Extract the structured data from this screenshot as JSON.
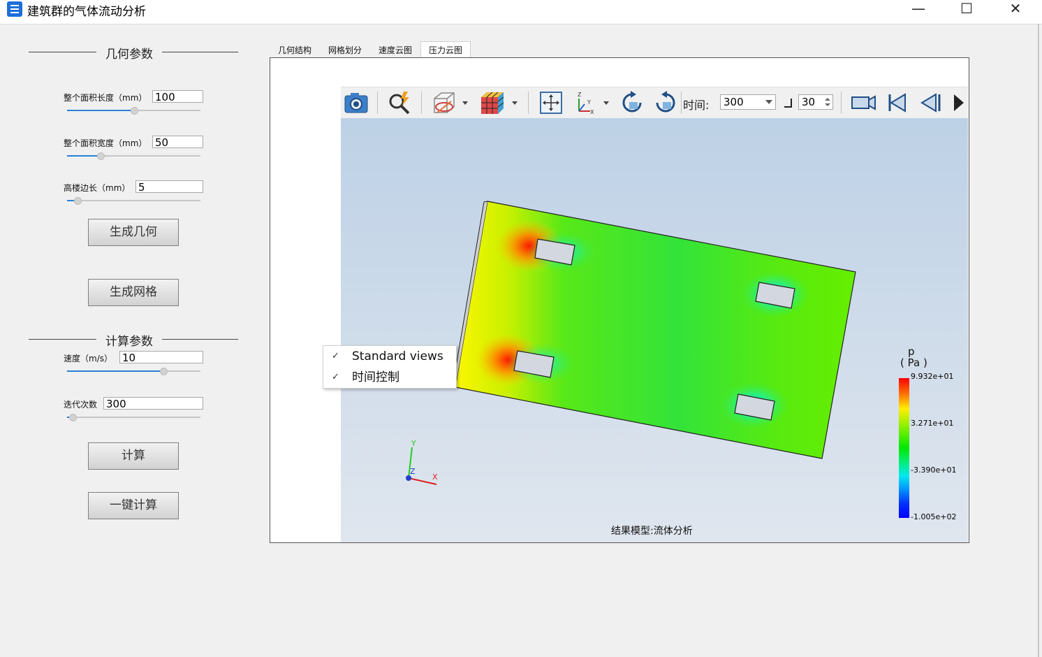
{
  "window": {
    "title": "建筑群的气体流动分析",
    "minimize": "—",
    "maximize": "☐",
    "close": "✕"
  },
  "geometry": {
    "heading": "几何参数",
    "length": {
      "label": "整个面积长度（mm）",
      "value": "100",
      "slider": 0.5
    },
    "width": {
      "label": "整个面积宽度（mm）",
      "value": "50",
      "slider": 0.25
    },
    "tower": {
      "label": "高楼边长（mm）",
      "value": "5",
      "slider": 0.08
    },
    "gen_geometry": "生成几何",
    "gen_mesh": "生成网格"
  },
  "compute": {
    "heading": "计算参数",
    "speed": {
      "label": "速度（m/s）",
      "value": "10",
      "slider": 0.72
    },
    "iter": {
      "label": "迭代次数",
      "value": "300",
      "slider": 0.04
    },
    "calc": "计算",
    "one_click": "一键计算"
  },
  "tabs": [
    "几何结构",
    "网格划分",
    "速度云图",
    "压力云图"
  ],
  "active_tab": 3,
  "toolbar": {
    "time_label": "时间:",
    "time_value": "300",
    "step_value": "30"
  },
  "context_menu": [
    "Standard views",
    "时间控制"
  ],
  "colorbar": {
    "var": "p",
    "unit": "( Pa )",
    "ticks": [
      "9.932e+01",
      "3.271e+01",
      "-3.390e+01",
      "-1.005e+02"
    ]
  },
  "axes": {
    "x": "X",
    "y": "Y",
    "z": "Z"
  },
  "caption": "结果模型:流体分析",
  "colors": {
    "accent": "#2a80d8",
    "app_icon": "#1e6fd9"
  }
}
